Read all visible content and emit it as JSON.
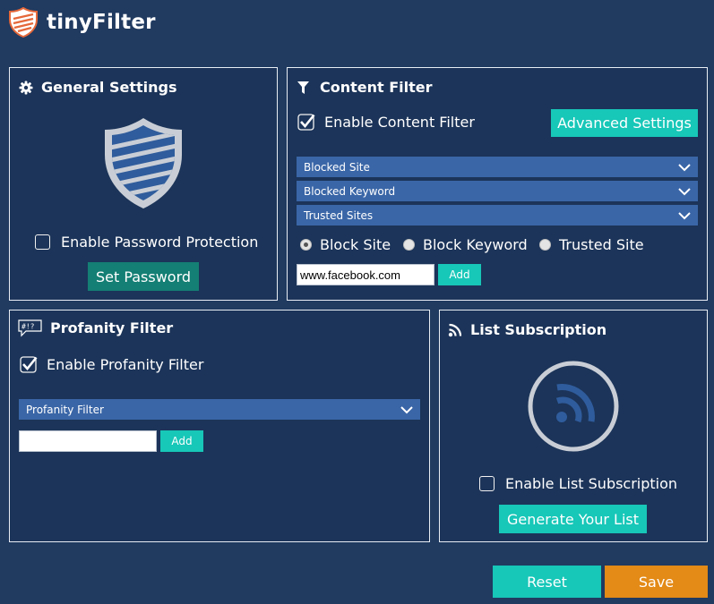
{
  "app": {
    "title": "tinyFilter"
  },
  "colors": {
    "background": "#203a60",
    "teal": "#17c7b8",
    "dark_teal": "#147f74",
    "orange": "#e38a17",
    "dropdown": "#3a66a7"
  },
  "general_settings": {
    "title": "General Settings",
    "icon": "gear-icon",
    "shield_icon": "shield-icon",
    "password_protection_label": "Enable Password Protection",
    "password_protection_checked": false,
    "set_password_label": "Set Password"
  },
  "content_filter": {
    "title": "Content Filter",
    "icon": "filter-icon",
    "enable_label": "Enable Content Filter",
    "enabled": true,
    "advanced_settings_label": "Advanced Settings",
    "dropdowns": [
      "Blocked Site",
      "Blocked Keyword",
      "Trusted Sites"
    ],
    "radios": [
      {
        "label": "Block Site",
        "selected": true
      },
      {
        "label": "Block Keyword",
        "selected": false
      },
      {
        "label": "Trusted Site",
        "selected": false
      }
    ],
    "input_value": "www.facebook.com",
    "add_label": "Add"
  },
  "profanity_filter": {
    "title": "Profanity Filter",
    "icon": "profanity-bubble-icon",
    "enable_label": "Enable Profanity Filter",
    "enabled": true,
    "dropdown_label": "Profanity Filter",
    "input_value": "",
    "add_label": "Add"
  },
  "list_subscription": {
    "title": "List Subscription",
    "icon": "rss-icon",
    "enable_label": "Enable List Subscription",
    "enabled": false,
    "generate_label": "Generate Your List"
  },
  "footer": {
    "reset_label": "Reset",
    "save_label": "Save"
  }
}
